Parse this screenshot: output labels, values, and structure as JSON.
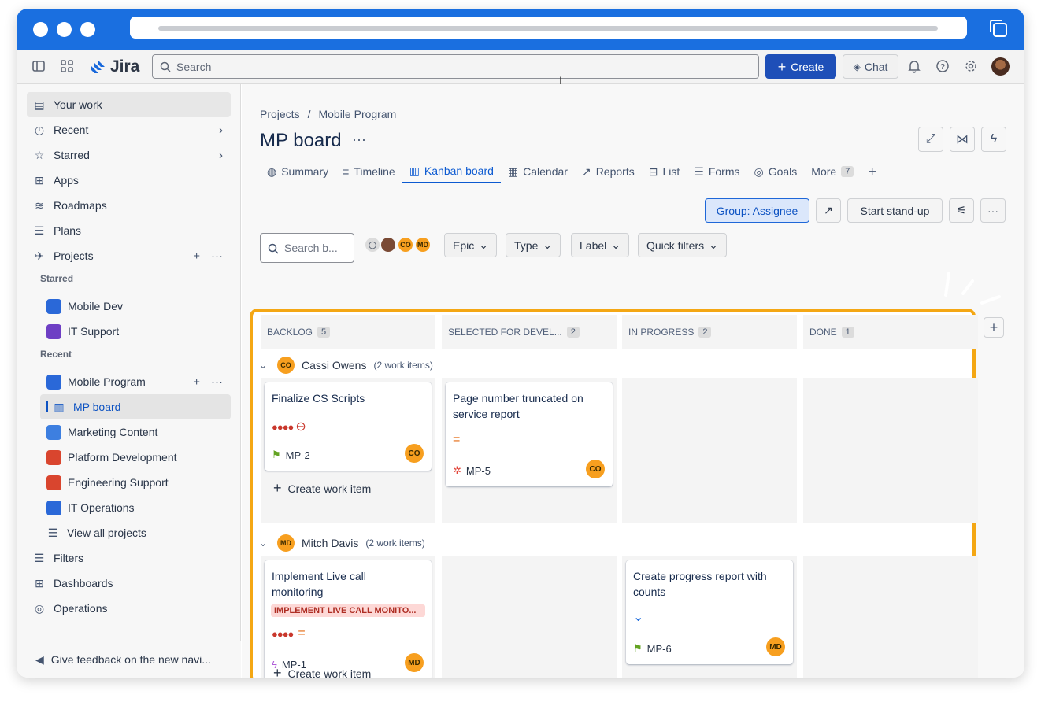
{
  "topnav": {
    "search_placeholder": "Search",
    "create_label": "Create",
    "chat_label": "Chat",
    "logo_text": "Jira"
  },
  "sidebar": {
    "your_work": "Your work",
    "recent": "Recent",
    "starred": "Starred",
    "apps": "Apps",
    "roadmaps": "Roadmaps",
    "plans": "Plans",
    "projects": "Projects",
    "starred_section": "Starred",
    "recent_section": "Recent",
    "starred_projects": [
      {
        "name": "Mobile Dev",
        "color": "#2a68d8"
      },
      {
        "name": "IT Support",
        "color": "#6e3fc4"
      }
    ],
    "recent_projects": [
      {
        "name": "Mobile Program",
        "color": "#2a68d8"
      },
      {
        "name": "MP board"
      },
      {
        "name": "Marketing Content",
        "color": "#3d7fe0"
      },
      {
        "name": "Platform Development",
        "color": "#d9452e"
      },
      {
        "name": "Engineering Support",
        "color": "#d9452e"
      },
      {
        "name": "IT Operations",
        "color": "#2a68d8"
      }
    ],
    "view_all": "View all projects",
    "filters": "Filters",
    "dashboards": "Dashboards",
    "operations": "Operations",
    "feedback": "Give feedback on the new navi..."
  },
  "page": {
    "breadcrumb": [
      "Projects",
      "/",
      "Mobile Program"
    ],
    "title": "MP board",
    "more": "···",
    "tabs": [
      "Summary",
      "Timeline",
      "Kanban board",
      "Calendar",
      "Reports",
      "List",
      "Forms",
      "Goals",
      "More"
    ],
    "more_count": "7",
    "group_label": "Group: Assignee",
    "standup_label": "Start stand-up",
    "board_search_placeholder": "Search b...",
    "filters": [
      "Epic",
      "Type",
      "Label",
      "Quick filters"
    ],
    "avatars": [
      "CO",
      "MD"
    ]
  },
  "board": {
    "columns": [
      {
        "name": "BACKLOG",
        "count": "5"
      },
      {
        "name": "SELECTED FOR DEVEL...",
        "count": "2"
      },
      {
        "name": "IN PROGRESS",
        "count": "2"
      },
      {
        "name": "DONE",
        "count": "1"
      }
    ],
    "swimlanes": [
      {
        "name": "Cassi Owens",
        "initials": "CO",
        "items": "(2 work items)"
      },
      {
        "name": "Mitch Davis",
        "initials": "MD",
        "items": "(2 work items)"
      }
    ],
    "cards": {
      "mp2": {
        "title": "Finalize CS Scripts",
        "key": "MP-2",
        "assignee": "CO"
      },
      "mp5": {
        "title": "Page number truncated on service report",
        "key": "MP-5",
        "assignee": "CO"
      },
      "mp1": {
        "title": "Implement Live call monitoring",
        "label": "IMPLEMENT LIVE CALL MONITO...",
        "key": "MP-1",
        "assignee": "MD"
      },
      "mp6": {
        "title": "Create progress report with counts",
        "key": "MP-6",
        "assignee": "MD"
      }
    },
    "create_label": "Create work item"
  },
  "colors": {
    "accent": "#1e4fb8",
    "highlight": "#f4a714",
    "titlebar": "#1a6fe0"
  }
}
